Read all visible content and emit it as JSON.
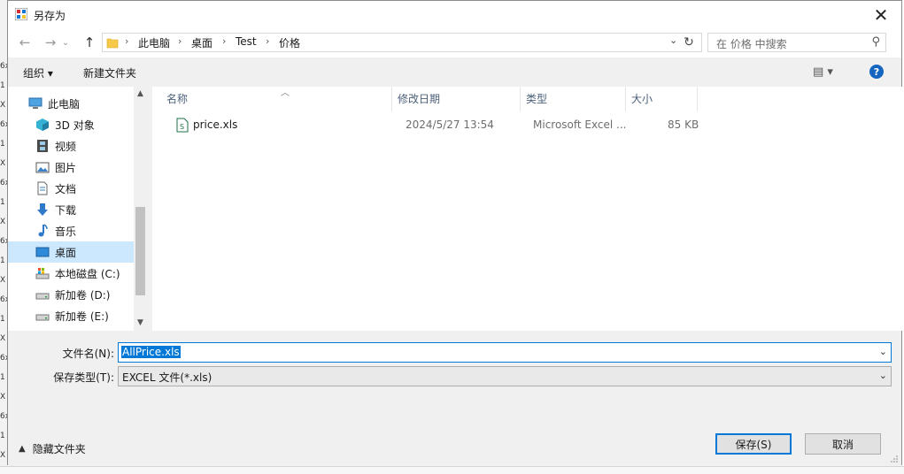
{
  "background_glyphs": [
    "6x",
    "1",
    "X",
    "6x",
    "1",
    "X",
    "6x",
    "1",
    "X",
    "6x",
    "1",
    "X",
    "6x",
    "1",
    "X",
    "6x",
    "1",
    "X",
    "6x",
    "1",
    "X",
    "6x",
    "1",
    "X"
  ],
  "dialog": {
    "title": "另存为",
    "close_label": "✕"
  },
  "nav": {
    "breadcrumb": [
      "此电脑",
      "桌面",
      "Test",
      "价格"
    ],
    "search_placeholder": "在 价格 中搜索"
  },
  "command_bar": {
    "organize_label": "组织 ▾",
    "new_folder_label": "新建文件夹",
    "view_icon": "▤ ▾"
  },
  "tree": {
    "items": [
      {
        "label": "此电脑",
        "icon": "computer-icon",
        "level": 0
      },
      {
        "label": "3D 对象",
        "icon": "cube-icon",
        "level": 1
      },
      {
        "label": "视频",
        "icon": "film-icon",
        "level": 1
      },
      {
        "label": "图片",
        "icon": "picture-icon",
        "level": 1
      },
      {
        "label": "文档",
        "icon": "document-icon",
        "level": 1
      },
      {
        "label": "下载",
        "icon": "download-arrow-icon",
        "level": 1
      },
      {
        "label": "音乐",
        "icon": "music-note-icon",
        "level": 1
      },
      {
        "label": "桌面",
        "icon": "desktop-icon",
        "level": 1,
        "selected": true
      },
      {
        "label": "本地磁盘 (C:)",
        "icon": "system-drive-icon",
        "level": 1
      },
      {
        "label": "新加卷 (D:)",
        "icon": "drive-icon",
        "level": 1
      },
      {
        "label": "新加卷 (E:)",
        "icon": "drive-icon",
        "level": 1
      }
    ]
  },
  "file_list": {
    "columns": [
      "名称",
      "修改日期",
      "类型",
      "大小"
    ],
    "rows": [
      {
        "name": "price.xls",
        "modified": "2024/5/27 13:54",
        "type": "Microsoft Excel ...",
        "size": "85 KB",
        "icon": "excel-file-icon"
      }
    ]
  },
  "form": {
    "filename_label": "文件名(N):",
    "filename_value": "AllPrice.xls",
    "filetype_label": "保存类型(T):",
    "filetype_value": "EXCEL 文件(*.xls)"
  },
  "footer": {
    "hide_folders_label": "隐藏文件夹",
    "save_label": "保存(S)",
    "cancel_label": "取消"
  },
  "colors": {
    "accent": "#0078d7",
    "selection": "#cce8ff",
    "help": "#1565c0"
  }
}
